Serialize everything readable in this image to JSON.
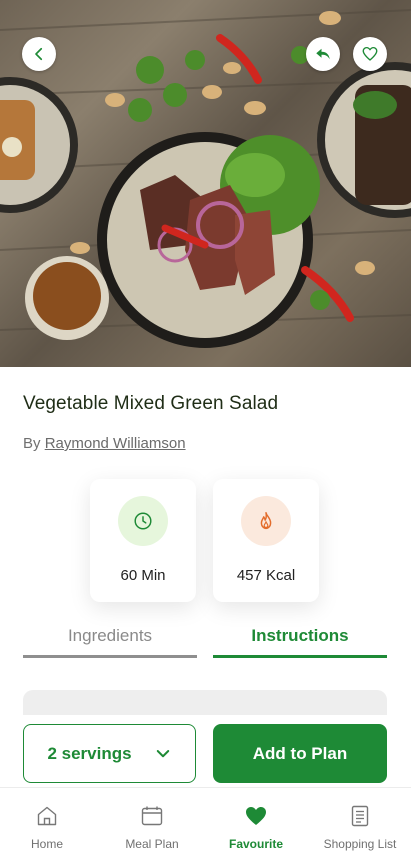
{
  "hero": {
    "back_icon": "chevron-left-icon",
    "share_icon": "reply-arrow-icon",
    "favorite_icon": "heart-outline-icon"
  },
  "recipe": {
    "title": "Vegetable Mixed Green Salad",
    "by_prefix": "By",
    "author": "Raymond Williamson"
  },
  "stats": {
    "time": {
      "icon": "clock-icon",
      "value": "60 Min"
    },
    "calories": {
      "icon": "flame-icon",
      "value": "457 Kcal"
    }
  },
  "tabs": [
    {
      "label": "Ingredients",
      "active": false
    },
    {
      "label": "Instructions",
      "active": true
    }
  ],
  "actions": {
    "servings_label": "2 servings",
    "servings_icon": "chevron-down-icon",
    "add_label": "Add to Plan"
  },
  "nav": [
    {
      "label": "Home",
      "icon": "home-icon",
      "active": false
    },
    {
      "label": "Meal Plan",
      "icon": "calendar-icon",
      "active": false
    },
    {
      "label": "Favourite",
      "icon": "heart-icon",
      "active": true
    },
    {
      "label": "Shopping List",
      "icon": "list-document-icon",
      "active": false
    }
  ],
  "colors": {
    "accent": "#1e8a36",
    "time_icon_bg": "#e6f6dc",
    "kcal_icon_bg": "#fbe9dd",
    "kcal_icon": "#e36c2b",
    "title_text": "#1f2d16"
  }
}
